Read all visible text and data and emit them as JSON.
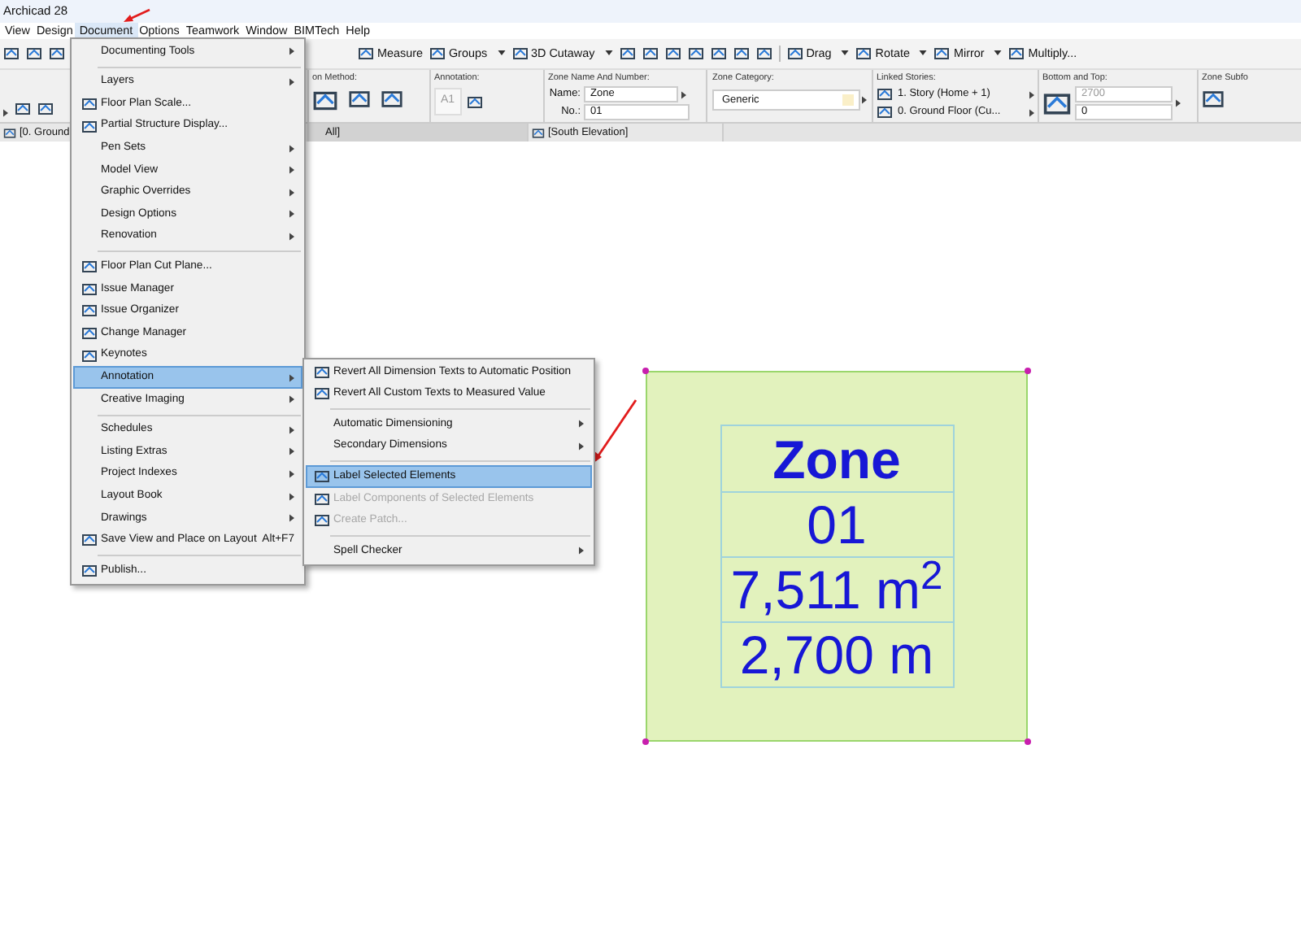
{
  "window": {
    "title": "Archicad 28"
  },
  "menubar": [
    {
      "label": "View",
      "selected": false
    },
    {
      "label": "Design",
      "selected": false
    },
    {
      "label": "Document",
      "selected": true
    },
    {
      "label": "Options",
      "selected": false
    },
    {
      "label": "Teamwork",
      "selected": false
    },
    {
      "label": "Window",
      "selected": false
    },
    {
      "label": "BIMTech",
      "selected": false
    },
    {
      "label": "Help",
      "selected": false
    }
  ],
  "toolbar": {
    "buttons": [
      {
        "label": "Measure",
        "dropdown": false
      },
      {
        "label": "Groups",
        "dropdown": true
      },
      {
        "label": "3D Cutaway",
        "dropdown": true
      },
      {
        "label": "Drag",
        "dropdown": true
      },
      {
        "label": "Rotate",
        "dropdown": true
      },
      {
        "label": "Mirror",
        "dropdown": true
      },
      {
        "label": "Multiply...",
        "dropdown": false
      }
    ]
  },
  "info_box": {
    "method_label": "on Method:",
    "annotation_label": "Annotation:",
    "annotation_text": "A1",
    "name_number_label": "Zone Name And Number:",
    "name_label": "Name:",
    "name_value": "Zone",
    "number_label": "No.:",
    "number_value": "01",
    "category_label": "Zone Category:",
    "category_value": "Generic",
    "linked_label": "Linked Stories:",
    "linked_top": "1. Story (Home + 1)",
    "linked_bottom": "0. Ground Floor (Cu...",
    "bottom_top_label": "Bottom and Top:",
    "top_value": "2700",
    "bottom_value": "0",
    "subfloor_label": "Zone Subfo"
  },
  "tabs": [
    {
      "label": "[0. Ground",
      "selected": false
    },
    {
      "label": "All]",
      "selected": true
    },
    {
      "label": "[South Elevation]",
      "selected": false
    }
  ],
  "menu": {
    "groups": [
      [
        {
          "label": "Documenting Tools",
          "submenu": true,
          "selected": false,
          "disabled": false
        }
      ],
      [
        {
          "label": "Layers",
          "submenu": true,
          "selected": false,
          "disabled": false
        },
        {
          "label": "Floor Plan Scale...",
          "submenu": false,
          "selected": false,
          "disabled": false
        },
        {
          "label": "Partial Structure Display...",
          "submenu": false,
          "selected": false,
          "disabled": false
        },
        {
          "label": "Pen Sets",
          "submenu": true,
          "selected": false,
          "disabled": false
        },
        {
          "label": "Model View",
          "submenu": true,
          "selected": false,
          "disabled": false
        },
        {
          "label": "Graphic Overrides",
          "submenu": true,
          "selected": false,
          "disabled": false
        },
        {
          "label": "Design Options",
          "submenu": true,
          "selected": false,
          "disabled": false
        },
        {
          "label": "Renovation",
          "submenu": true,
          "selected": false,
          "disabled": false
        }
      ],
      [
        {
          "label": "Floor Plan Cut Plane...",
          "submenu": false,
          "selected": false,
          "disabled": false
        },
        {
          "label": "Issue Manager",
          "submenu": false,
          "selected": false,
          "disabled": false
        },
        {
          "label": "Issue Organizer",
          "submenu": false,
          "selected": false,
          "disabled": false
        },
        {
          "label": "Change Manager",
          "submenu": false,
          "selected": false,
          "disabled": false
        },
        {
          "label": "Keynotes",
          "submenu": false,
          "selected": false,
          "disabled": false
        },
        {
          "label": "Annotation",
          "submenu": true,
          "selected": true,
          "disabled": false
        },
        {
          "label": "Creative Imaging",
          "submenu": true,
          "selected": false,
          "disabled": false
        }
      ],
      [
        {
          "label": "Schedules",
          "submenu": true,
          "selected": false,
          "disabled": false
        },
        {
          "label": "Listing Extras",
          "submenu": true,
          "selected": false,
          "disabled": false
        },
        {
          "label": "Project Indexes",
          "submenu": true,
          "selected": false,
          "disabled": false
        },
        {
          "label": "Layout Book",
          "submenu": true,
          "selected": false,
          "disabled": false
        },
        {
          "label": "Drawings",
          "submenu": true,
          "selected": false,
          "disabled": false
        },
        {
          "label": "Save View and Place on Layout",
          "submenu": false,
          "selected": false,
          "disabled": false,
          "shortcut": "Alt+F7"
        }
      ],
      [
        {
          "label": "Publish...",
          "submenu": false,
          "selected": false,
          "disabled": false
        }
      ]
    ]
  },
  "submenu": {
    "groups": [
      [
        {
          "label": "Revert All Dimension Texts to Automatic Position",
          "submenu": false,
          "selected": false,
          "disabled": false
        },
        {
          "label": "Revert All Custom Texts to Measured Value",
          "submenu": false,
          "selected": false,
          "disabled": false
        }
      ],
      [
        {
          "label": "Automatic Dimensioning",
          "submenu": true,
          "selected": false,
          "disabled": false
        },
        {
          "label": "Secondary Dimensions",
          "submenu": true,
          "selected": false,
          "disabled": false
        }
      ],
      [
        {
          "label": "Label Selected Elements",
          "submenu": false,
          "selected": true,
          "disabled": false
        },
        {
          "label": "Label Components of Selected Elements",
          "submenu": false,
          "selected": false,
          "disabled": true
        },
        {
          "label": "Create Patch...",
          "submenu": false,
          "selected": false,
          "disabled": true
        }
      ],
      [
        {
          "label": "Spell Checker",
          "submenu": true,
          "selected": false,
          "disabled": false
        }
      ]
    ]
  },
  "zone_stamp": {
    "rows": [
      {
        "kind": "name",
        "text": "Zone"
      },
      {
        "kind": "value",
        "text": "01"
      },
      {
        "kind": "value",
        "text": "7,511 m$^{2}$"
      },
      {
        "kind": "value",
        "text": "2,700 m"
      }
    ]
  }
}
